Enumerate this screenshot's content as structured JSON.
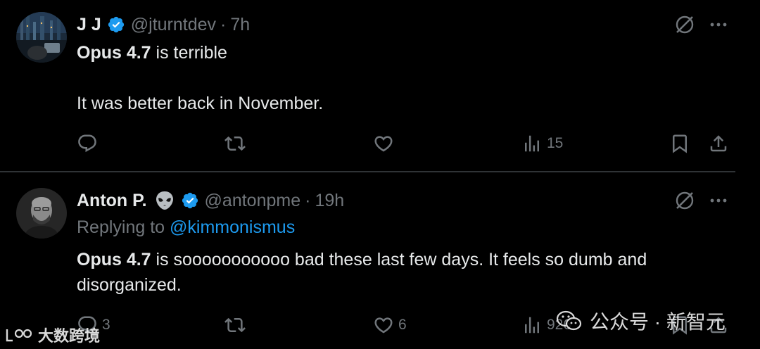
{
  "tweets": [
    {
      "name": "J J",
      "handle": "@jturntdev",
      "separator": "·",
      "time": "7h",
      "body_bold": "Opus 4.7",
      "body_rest": " is terrible",
      "body_line2": "It was better back in November.",
      "actions": {
        "replies": "",
        "retweets": "",
        "likes": "",
        "views": "15"
      }
    },
    {
      "name": "Anton P.",
      "name_emoji": "alien-emoji",
      "handle": "@antonpme",
      "separator": "·",
      "time": "19h",
      "replying_prefix": "Replying to ",
      "replying_handle": "@kimmonismus",
      "body_bold": "Opus 4.7",
      "body_rest": " is sooooooooooo bad these last few days. It feels so dumb and disorganized.",
      "actions": {
        "replies": "3",
        "retweets": "",
        "likes": "6",
        "views": "926"
      }
    }
  ],
  "watermarks": {
    "left": "大数跨境",
    "right": "公众号 · 新智元"
  },
  "colors": {
    "background": "#000000",
    "text": "#e7e9ea",
    "muted": "#71767b",
    "link": "#1d9bf0",
    "verified": "#1d9bf0",
    "divider": "#2f3336"
  }
}
